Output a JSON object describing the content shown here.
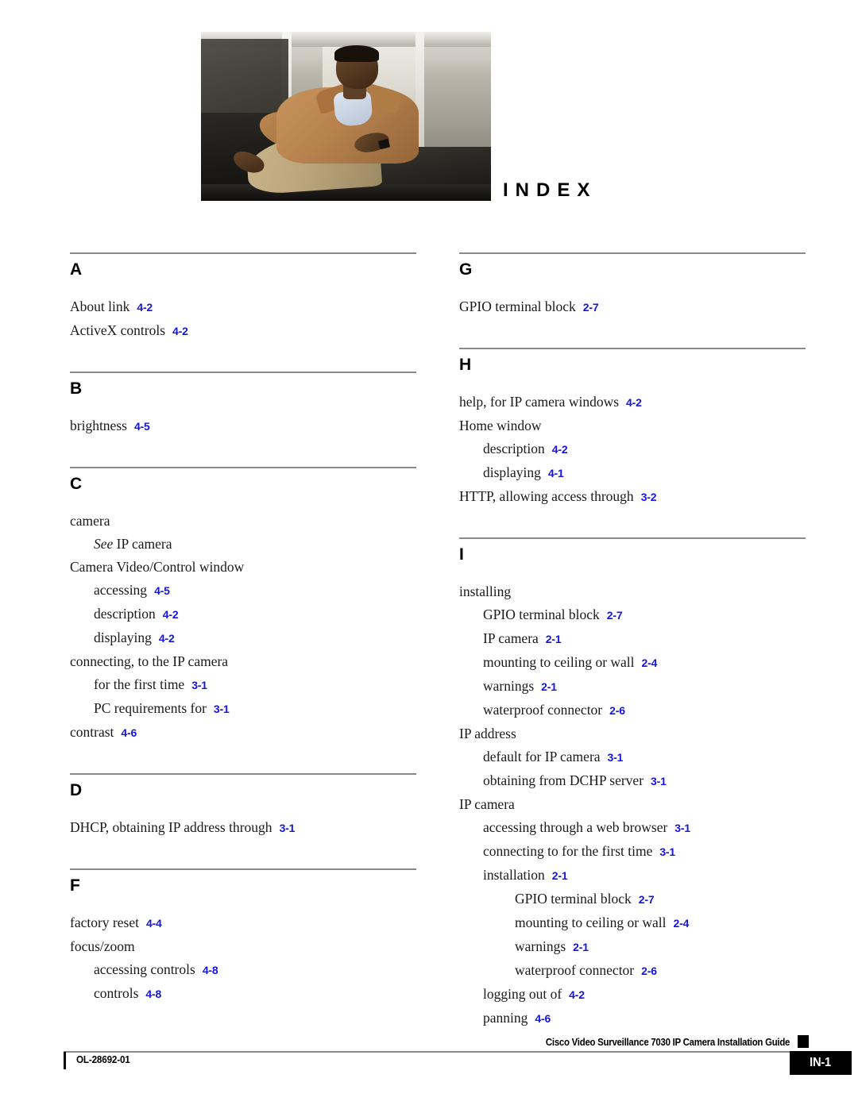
{
  "document": {
    "title": "INDEX",
    "hero_image_alt": "man-seated-in-lobby-photo"
  },
  "columns": [
    {
      "id": "left",
      "sections": [
        {
          "letter": "A",
          "entries": [
            {
              "level": 0,
              "text": "About link",
              "page": "4-2"
            },
            {
              "level": 0,
              "text": "ActiveX controls",
              "page": "4-2"
            }
          ]
        },
        {
          "letter": "B",
          "entries": [
            {
              "level": 0,
              "text": "brightness",
              "page": "4-5"
            }
          ]
        },
        {
          "letter": "C",
          "entries": [
            {
              "level": 0,
              "text": "camera",
              "page": ""
            },
            {
              "level": 1,
              "italic_prefix": "See",
              "text": "IP camera",
              "page": ""
            },
            {
              "level": 0,
              "text": "Camera Video/Control window",
              "page": ""
            },
            {
              "level": 1,
              "text": "accessing",
              "page": "4-5"
            },
            {
              "level": 1,
              "text": "description",
              "page": "4-2"
            },
            {
              "level": 1,
              "text": "displaying",
              "page": "4-2"
            },
            {
              "level": 0,
              "text": "connecting, to the IP camera",
              "page": ""
            },
            {
              "level": 1,
              "text": "for the first time",
              "page": "3-1"
            },
            {
              "level": 1,
              "text": "PC requirements for",
              "page": "3-1"
            },
            {
              "level": 0,
              "text": "contrast",
              "page": "4-6"
            }
          ]
        },
        {
          "letter": "D",
          "entries": [
            {
              "level": 0,
              "text": "DHCP, obtaining IP address through",
              "page": "3-1"
            }
          ]
        },
        {
          "letter": "F",
          "entries": [
            {
              "level": 0,
              "text": "factory reset",
              "page": "4-4"
            },
            {
              "level": 0,
              "text": "focus/zoom",
              "page": ""
            },
            {
              "level": 1,
              "text": "accessing controls",
              "page": "4-8"
            },
            {
              "level": 1,
              "text": "controls",
              "page": "4-8"
            }
          ]
        }
      ]
    },
    {
      "id": "right",
      "sections": [
        {
          "letter": "G",
          "entries": [
            {
              "level": 0,
              "text": "GPIO terminal block",
              "page": "2-7"
            }
          ]
        },
        {
          "letter": "H",
          "entries": [
            {
              "level": 0,
              "text": "help, for IP camera windows",
              "page": "4-2"
            },
            {
              "level": 0,
              "text": "Home window",
              "page": ""
            },
            {
              "level": 1,
              "text": "description",
              "page": "4-2"
            },
            {
              "level": 1,
              "text": "displaying",
              "page": "4-1"
            },
            {
              "level": 0,
              "text": "HTTP, allowing access through",
              "page": "3-2"
            }
          ]
        },
        {
          "letter": "I",
          "entries": [
            {
              "level": 0,
              "text": "installing",
              "page": ""
            },
            {
              "level": 1,
              "text": "GPIO terminal block",
              "page": "2-7"
            },
            {
              "level": 1,
              "text": "IP camera",
              "page": "2-1"
            },
            {
              "level": 1,
              "text": "mounting to ceiling or wall",
              "page": "2-4"
            },
            {
              "level": 1,
              "text": "warnings",
              "page": "2-1"
            },
            {
              "level": 1,
              "text": "waterproof connector",
              "page": "2-6"
            },
            {
              "level": 0,
              "text": "IP address",
              "page": ""
            },
            {
              "level": 1,
              "text": "default for IP camera",
              "page": "3-1"
            },
            {
              "level": 1,
              "text": "obtaining from DCHP server",
              "page": "3-1"
            },
            {
              "level": 0,
              "text": "IP camera",
              "page": ""
            },
            {
              "level": 1,
              "text": "accessing through a web browser",
              "page": "3-1"
            },
            {
              "level": 1,
              "text": "connecting to for the first time",
              "page": "3-1"
            },
            {
              "level": 1,
              "text": "installation",
              "page": "2-1"
            },
            {
              "level": 2,
              "text": "GPIO terminal block",
              "page": "2-7"
            },
            {
              "level": 2,
              "text": "mounting to ceiling or wall",
              "page": "2-4"
            },
            {
              "level": 2,
              "text": "warnings",
              "page": "2-1"
            },
            {
              "level": 2,
              "text": "waterproof connector",
              "page": "2-6"
            },
            {
              "level": 1,
              "text": "logging out of",
              "page": "4-2"
            },
            {
              "level": 1,
              "text": "panning",
              "page": "4-6"
            }
          ]
        }
      ]
    }
  ],
  "footer": {
    "guide_title": "Cisco Video Surveillance 7030 IP Camera Installation Guide",
    "doc_number": "OL-28692-01",
    "page_number": "IN-1"
  },
  "colors": {
    "page_link": "#1414e6",
    "rule": "#8a8a8a",
    "text": "#1a1a1a"
  }
}
